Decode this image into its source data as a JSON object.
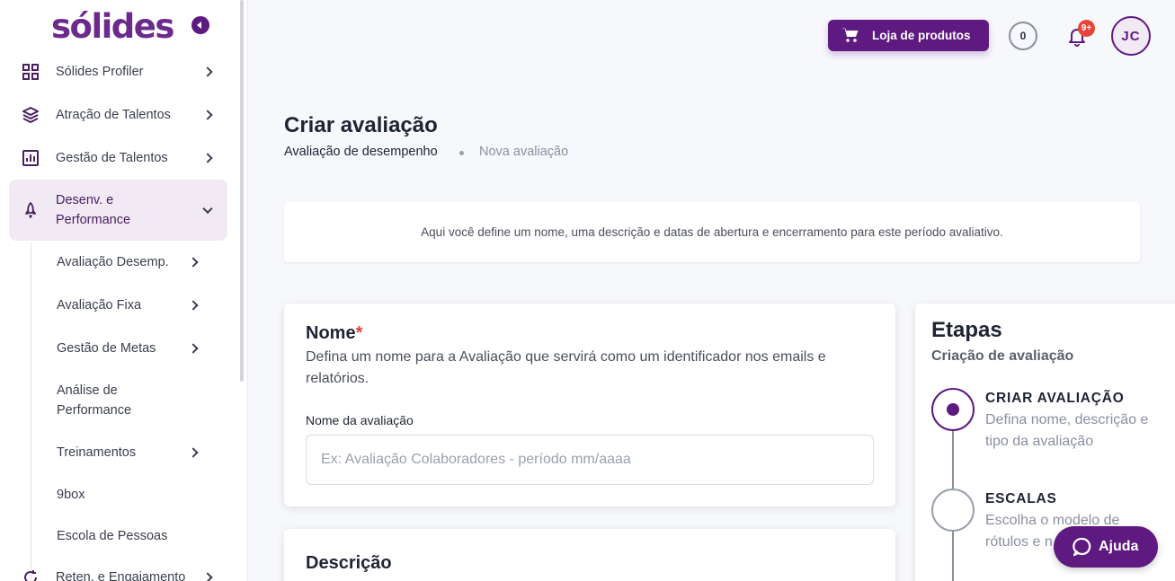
{
  "sidebar": {
    "logo": "sólides",
    "items": [
      {
        "label": "Sólides Profiler"
      },
      {
        "label": "Atração de Talentos"
      },
      {
        "label": "Gestão de Talentos"
      },
      {
        "label_line1": "Desenv. e",
        "label_line2": "Performance"
      },
      {
        "label": "Reten. e Engajamento"
      }
    ],
    "subitems": [
      {
        "label": "Avaliação Desemp."
      },
      {
        "label": "Avaliação Fixa"
      },
      {
        "label": "Gestão de Metas"
      },
      {
        "label_line1": "Análise de",
        "label_line2": "Performance"
      },
      {
        "label": "Treinamentos"
      },
      {
        "label": "9box"
      },
      {
        "label": "Escola de Pessoas"
      }
    ]
  },
  "header": {
    "store_label": "Loja de produtos",
    "coins": "0",
    "notifications_badge": "9+",
    "avatar_initials": "JC"
  },
  "page": {
    "title": "Criar avaliação",
    "breadcrumb": [
      "Avaliação de desempenho",
      "Nova avaliação"
    ],
    "info_text": "Aqui você define um nome, uma descrição e datas de abertura e encerramento para este período avaliativo."
  },
  "name_card": {
    "title": "Nome",
    "required_mark": "*",
    "description": "Defina um nome para a Avaliação que servirá como um identificador nos emails e relatórios.",
    "field_label": "Nome da avaliação",
    "field_placeholder": "Ex: Avaliação Colaboradores - período mm/aaaa",
    "field_value": ""
  },
  "desc_card": {
    "title": "Descrição"
  },
  "steps": {
    "title": "Etapas",
    "subtitle": "Criação de avaliação",
    "items": [
      {
        "title": "CRIAR AVALIAÇÃO",
        "desc": "Defina nome, descrição e tipo da avaliação"
      },
      {
        "title": "ESCALAS",
        "desc": "Escolha o modelo de rótulos e n"
      }
    ]
  },
  "help": {
    "label": "Ajuda"
  },
  "colors": {
    "brand": "#5e1a80",
    "badge": "#e7453c"
  }
}
